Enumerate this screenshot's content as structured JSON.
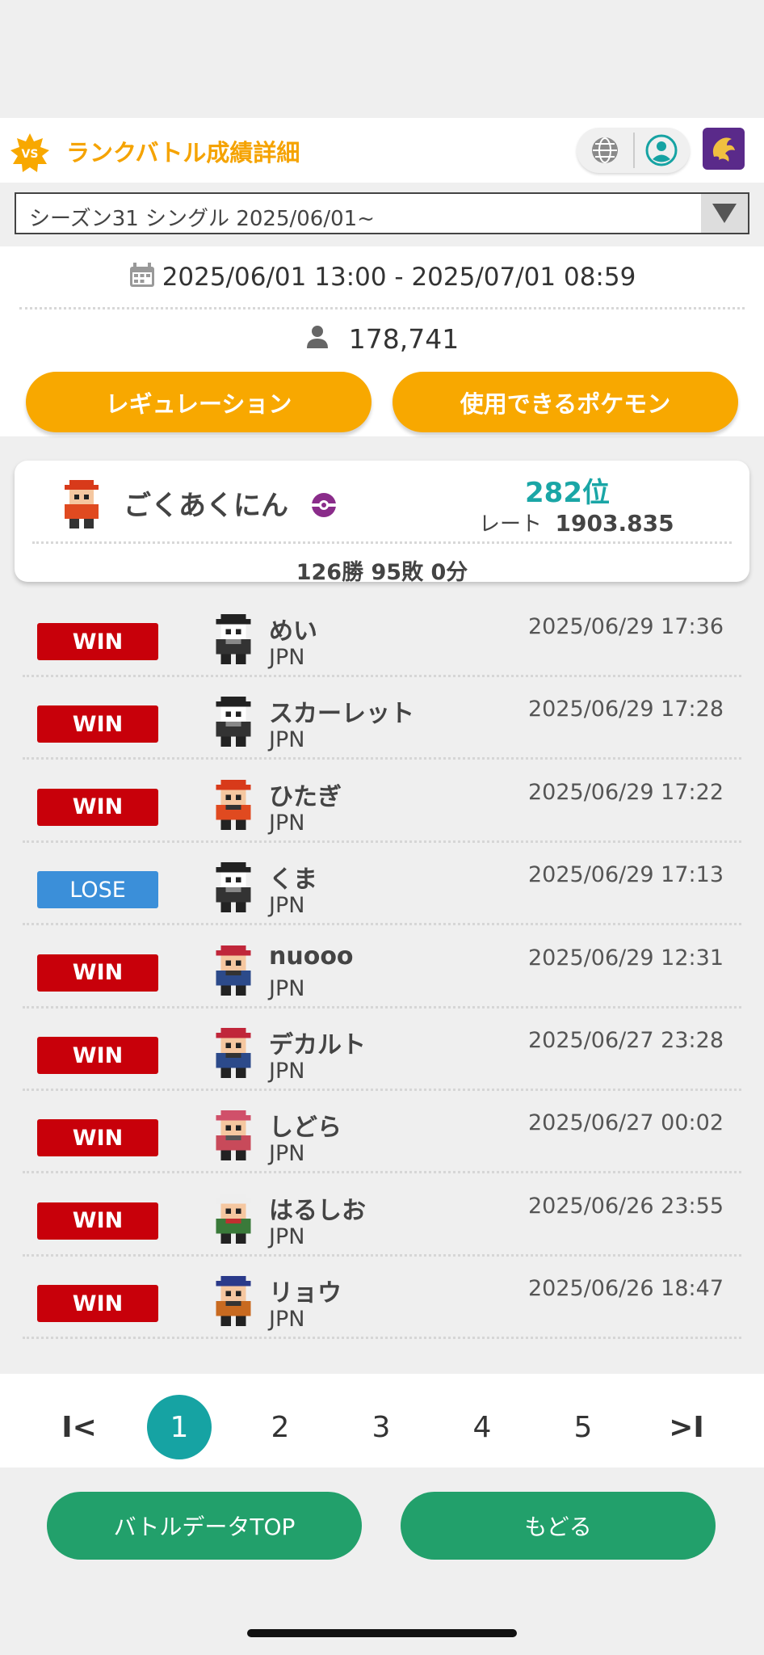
{
  "header": {
    "vs_label": "VS",
    "title": "ランクバトル成績詳細"
  },
  "season": {
    "selected": "シーズン31 シングル 2025/06/01~"
  },
  "info": {
    "period": "2025/06/01 13:00 - 2025/07/01 08:59",
    "player_count": "178,741",
    "regulation_button": "レギュレーション",
    "usable_pokemon_button": "使用できるポケモン"
  },
  "player": {
    "name": "ごくあくにん",
    "rank": "282位",
    "rate_label": "レート",
    "rate_value": "1903.835",
    "record": "126勝 95敗 0分"
  },
  "battles": [
    {
      "result": "WIN",
      "name": "めい",
      "country": "JPN",
      "time": "2025/06/29 17:36",
      "avatar": "dark"
    },
    {
      "result": "WIN",
      "name": "スカーレット",
      "country": "JPN",
      "time": "2025/06/29 17:28",
      "avatar": "dark"
    },
    {
      "result": "WIN",
      "name": "ひたぎ",
      "country": "JPN",
      "time": "2025/06/29 17:22",
      "avatar": "red"
    },
    {
      "result": "LOSE",
      "name": "くま",
      "country": "JPN",
      "time": "2025/06/29 17:13",
      "avatar": "dark"
    },
    {
      "result": "WIN",
      "name": "nuooo",
      "country": "JPN",
      "time": "2025/06/29 12:31",
      "avatar": "blue"
    },
    {
      "result": "WIN",
      "name": "デカルト",
      "country": "JPN",
      "time": "2025/06/27 23:28",
      "avatar": "blue"
    },
    {
      "result": "WIN",
      "name": "しどら",
      "country": "JPN",
      "time": "2025/06/27 00:02",
      "avatar": "pink"
    },
    {
      "result": "WIN",
      "name": "はるしお",
      "country": "JPN",
      "time": "2025/06/26 23:55",
      "avatar": "green"
    },
    {
      "result": "WIN",
      "name": "リョウ",
      "country": "JPN",
      "time": "2025/06/26 18:47",
      "avatar": "brown"
    }
  ],
  "pagination": {
    "first": "I<",
    "pages": [
      "1",
      "2",
      "3",
      "4",
      "5"
    ],
    "current": "1",
    "last": ">I"
  },
  "footer": {
    "top_button": "バトルデータTOP",
    "back_button": "もどる"
  },
  "colors": {
    "accent_orange": "#f5a300",
    "win_red": "#c8000a",
    "lose_blue": "#3b8fd9",
    "teal": "#16a3a3",
    "green": "#22a06b"
  }
}
